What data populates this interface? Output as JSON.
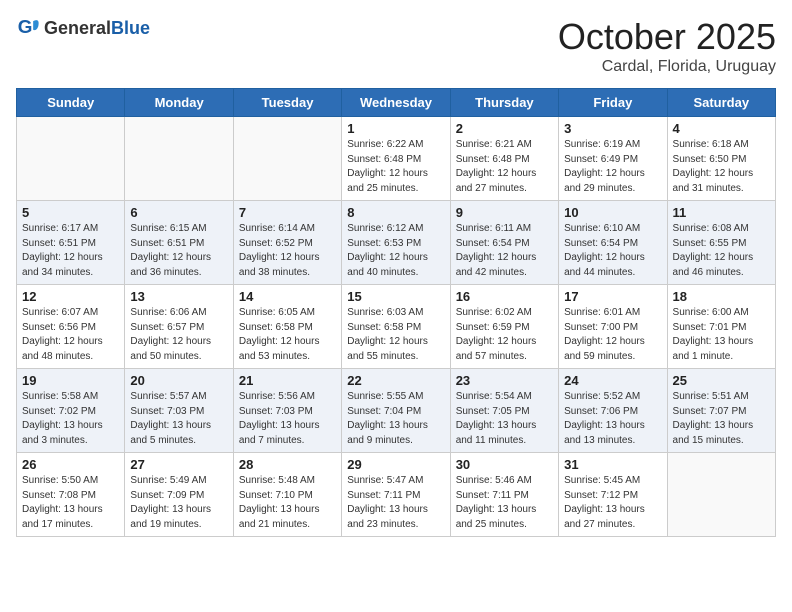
{
  "header": {
    "logo_general": "General",
    "logo_blue": "Blue",
    "month": "October 2025",
    "location": "Cardal, Florida, Uruguay"
  },
  "weekdays": [
    "Sunday",
    "Monday",
    "Tuesday",
    "Wednesday",
    "Thursday",
    "Friday",
    "Saturday"
  ],
  "weeks": [
    [
      {
        "day": "",
        "info": ""
      },
      {
        "day": "",
        "info": ""
      },
      {
        "day": "",
        "info": ""
      },
      {
        "day": "1",
        "info": "Sunrise: 6:22 AM\nSunset: 6:48 PM\nDaylight: 12 hours\nand 25 minutes."
      },
      {
        "day": "2",
        "info": "Sunrise: 6:21 AM\nSunset: 6:48 PM\nDaylight: 12 hours\nand 27 minutes."
      },
      {
        "day": "3",
        "info": "Sunrise: 6:19 AM\nSunset: 6:49 PM\nDaylight: 12 hours\nand 29 minutes."
      },
      {
        "day": "4",
        "info": "Sunrise: 6:18 AM\nSunset: 6:50 PM\nDaylight: 12 hours\nand 31 minutes."
      }
    ],
    [
      {
        "day": "5",
        "info": "Sunrise: 6:17 AM\nSunset: 6:51 PM\nDaylight: 12 hours\nand 34 minutes."
      },
      {
        "day": "6",
        "info": "Sunrise: 6:15 AM\nSunset: 6:51 PM\nDaylight: 12 hours\nand 36 minutes."
      },
      {
        "day": "7",
        "info": "Sunrise: 6:14 AM\nSunset: 6:52 PM\nDaylight: 12 hours\nand 38 minutes."
      },
      {
        "day": "8",
        "info": "Sunrise: 6:12 AM\nSunset: 6:53 PM\nDaylight: 12 hours\nand 40 minutes."
      },
      {
        "day": "9",
        "info": "Sunrise: 6:11 AM\nSunset: 6:54 PM\nDaylight: 12 hours\nand 42 minutes."
      },
      {
        "day": "10",
        "info": "Sunrise: 6:10 AM\nSunset: 6:54 PM\nDaylight: 12 hours\nand 44 minutes."
      },
      {
        "day": "11",
        "info": "Sunrise: 6:08 AM\nSunset: 6:55 PM\nDaylight: 12 hours\nand 46 minutes."
      }
    ],
    [
      {
        "day": "12",
        "info": "Sunrise: 6:07 AM\nSunset: 6:56 PM\nDaylight: 12 hours\nand 48 minutes."
      },
      {
        "day": "13",
        "info": "Sunrise: 6:06 AM\nSunset: 6:57 PM\nDaylight: 12 hours\nand 50 minutes."
      },
      {
        "day": "14",
        "info": "Sunrise: 6:05 AM\nSunset: 6:58 PM\nDaylight: 12 hours\nand 53 minutes."
      },
      {
        "day": "15",
        "info": "Sunrise: 6:03 AM\nSunset: 6:58 PM\nDaylight: 12 hours\nand 55 minutes."
      },
      {
        "day": "16",
        "info": "Sunrise: 6:02 AM\nSunset: 6:59 PM\nDaylight: 12 hours\nand 57 minutes."
      },
      {
        "day": "17",
        "info": "Sunrise: 6:01 AM\nSunset: 7:00 PM\nDaylight: 12 hours\nand 59 minutes."
      },
      {
        "day": "18",
        "info": "Sunrise: 6:00 AM\nSunset: 7:01 PM\nDaylight: 13 hours\nand 1 minute."
      }
    ],
    [
      {
        "day": "19",
        "info": "Sunrise: 5:58 AM\nSunset: 7:02 PM\nDaylight: 13 hours\nand 3 minutes."
      },
      {
        "day": "20",
        "info": "Sunrise: 5:57 AM\nSunset: 7:03 PM\nDaylight: 13 hours\nand 5 minutes."
      },
      {
        "day": "21",
        "info": "Sunrise: 5:56 AM\nSunset: 7:03 PM\nDaylight: 13 hours\nand 7 minutes."
      },
      {
        "day": "22",
        "info": "Sunrise: 5:55 AM\nSunset: 7:04 PM\nDaylight: 13 hours\nand 9 minutes."
      },
      {
        "day": "23",
        "info": "Sunrise: 5:54 AM\nSunset: 7:05 PM\nDaylight: 13 hours\nand 11 minutes."
      },
      {
        "day": "24",
        "info": "Sunrise: 5:52 AM\nSunset: 7:06 PM\nDaylight: 13 hours\nand 13 minutes."
      },
      {
        "day": "25",
        "info": "Sunrise: 5:51 AM\nSunset: 7:07 PM\nDaylight: 13 hours\nand 15 minutes."
      }
    ],
    [
      {
        "day": "26",
        "info": "Sunrise: 5:50 AM\nSunset: 7:08 PM\nDaylight: 13 hours\nand 17 minutes."
      },
      {
        "day": "27",
        "info": "Sunrise: 5:49 AM\nSunset: 7:09 PM\nDaylight: 13 hours\nand 19 minutes."
      },
      {
        "day": "28",
        "info": "Sunrise: 5:48 AM\nSunset: 7:10 PM\nDaylight: 13 hours\nand 21 minutes."
      },
      {
        "day": "29",
        "info": "Sunrise: 5:47 AM\nSunset: 7:11 PM\nDaylight: 13 hours\nand 23 minutes."
      },
      {
        "day": "30",
        "info": "Sunrise: 5:46 AM\nSunset: 7:11 PM\nDaylight: 13 hours\nand 25 minutes."
      },
      {
        "day": "31",
        "info": "Sunrise: 5:45 AM\nSunset: 7:12 PM\nDaylight: 13 hours\nand 27 minutes."
      },
      {
        "day": "",
        "info": ""
      }
    ]
  ]
}
